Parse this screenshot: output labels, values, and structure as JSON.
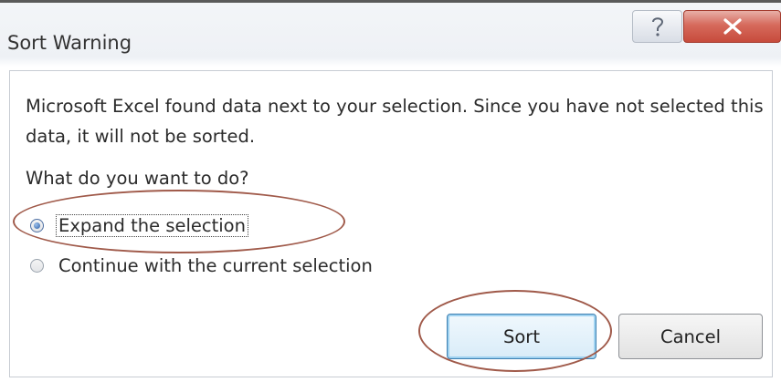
{
  "dialog": {
    "title": "Sort Warning",
    "help_symbol": "?",
    "close_symbol": "X"
  },
  "message": "Microsoft Excel found data next to your selection.  Since you have not selected this data, it will not be sorted.",
  "question": "What do you want to do?",
  "options": [
    {
      "label": "Expand the selection",
      "selected": true
    },
    {
      "label": "Continue with the current selection",
      "selected": false
    }
  ],
  "buttons": {
    "sort_label": "Sort",
    "cancel_label": "Cancel"
  },
  "colors": {
    "annotation": "#a05a4a",
    "close_button": "#c74b3c",
    "default_button_border": "#3c7fb1"
  }
}
